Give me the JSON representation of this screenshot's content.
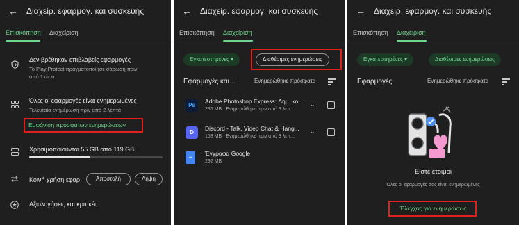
{
  "panel1": {
    "back_icon": "arrow-back-icon",
    "title": "Διαχείρ. εφαρμογ. και συσκευής",
    "tabs": [
      {
        "label": "Επισκόπηση",
        "active": true
      },
      {
        "label": "Διαχείριση",
        "active": false
      }
    ],
    "protect": {
      "icon": "shield-icon",
      "title": "Δεν βρέθηκαν επιβλαβείς εφαρμογές",
      "sub1": "Το Play Protect πραγματοποίησε σάρωση πριν",
      "sub2": "από 1 ώρα."
    },
    "updates": {
      "icon": "apps-grid-icon",
      "title": "Όλες οι εφαρμογές είναι ενημερωμένες",
      "sub": "Τελευταία ενημέρωση πριν από 2 λεπτά",
      "link": "Εμφάνιση πρόσφατων ενημερώσεων"
    },
    "storage": {
      "icon": "storage-icon",
      "title": "Χρησιμοποιούνται 55 GB από 119 GB",
      "used_fraction": 0.46
    },
    "share": {
      "icon": "share-swap-icon",
      "title": "Κοινή χρήση εφαρ",
      "send_label": "Αποστολή",
      "receive_label": "Λήψη"
    },
    "ratings": {
      "icon": "star-badge-icon",
      "title": "Αξιολογήσεις και κριτικές"
    }
  },
  "panel2": {
    "title": "Διαχείρ. εφαρμογ. και συσκευής",
    "tabs": [
      {
        "label": "Επισκόπηση",
        "active": false
      },
      {
        "label": "Διαχείριση",
        "active": true
      }
    ],
    "chip_installed": "Εγκατεστημένες",
    "chip_updates": "Διαθέσιμες ενημερώσεις",
    "section_title": "Εφαρμογές και ...",
    "sort_label": "Ενημερώθηκε πρόσφατα",
    "apps": [
      {
        "name": "Adobe Photoshop Express: Δημ. κο...",
        "meta": "236 MB · Ενημερώθηκε πριν από 3 λεπ...",
        "icon": "Ps",
        "color": "#0a1a3a",
        "fg": "#31a8ff"
      },
      {
        "name": "Discord - Talk, Video Chat & Hang...",
        "meta": "158 MB · Ενημερώθηκε πριν από 3 λεπ...",
        "icon": "D",
        "color": "#5865f2",
        "fg": "#ffffff"
      },
      {
        "name": "Έγγραφα Google",
        "meta": "292 MB",
        "icon": "≡",
        "color": "#4285f4",
        "fg": "#ffffff"
      }
    ]
  },
  "panel3": {
    "title": "Διαχείρ. εφαρμογ. και συσκευής",
    "tabs": [
      {
        "label": "Επισκόπηση",
        "active": false
      },
      {
        "label": "Διαχείριση",
        "active": true
      }
    ],
    "chip_installed": "Εγκατεστημένες",
    "chip_updates": "Διαθέσιμες ενημερώσεις",
    "section_title": "Εφαρμογές",
    "sort_label": "Ενημερώθηκε πρόσφατα",
    "ready_title": "Είστε έτοιμοι",
    "ready_sub": "Όλες οι εφαρμογές σας είναι ενημερωμένες",
    "check_link": "Έλεγχος για ενημερώσεις"
  },
  "colors": {
    "background": "#1f1f1f",
    "accent": "#6dd58c",
    "highlight_box": "#e0201d"
  }
}
